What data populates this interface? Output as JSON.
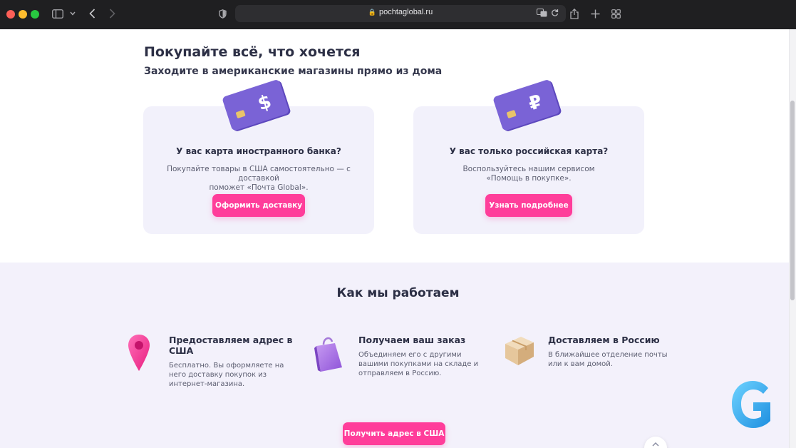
{
  "browser": {
    "url": "pochtaglobal.ru"
  },
  "hero": {
    "title": "Покупайте всё, что хочется",
    "subtitle": "Заходите в американские магазины прямо из дома"
  },
  "cards": [
    {
      "currency_symbol": "$",
      "heading": "У вас карта иностранного банка?",
      "text_line1": "Покупайте товары в США самостоятельно — с доставкой",
      "text_line2": "поможет «Почта Global».",
      "button": "Оформить доставку"
    },
    {
      "currency_symbol": "₽",
      "heading": "У вас только российская карта?",
      "text_line1": "Воспользуйтесь нашим сервисом",
      "text_line2": "«Помощь в покупке».",
      "button": "Узнать подробнее"
    }
  ],
  "how": {
    "title": "Как мы работаем",
    "steps": [
      {
        "icon": "map-pin-icon",
        "title_line1": "Предоставляем адрес в",
        "title_line2": "США",
        "text_line1": "Бесплатно. Вы оформляете на",
        "text_line2": "него доставку покупок из",
        "text_line3": "интернет-магазина."
      },
      {
        "icon": "shopping-bag-icon",
        "title_line1": "Получаем ваш заказ",
        "text_line1": "Объединяем его с другими",
        "text_line2": "вашими покупками на складе и",
        "text_line3": "отправляем в Россию."
      },
      {
        "icon": "parcel-box-icon",
        "title_line1": "Доставляем в Россию",
        "text_line1": "В ближайшее отделение почты",
        "text_line2": "или к вам домой."
      }
    ],
    "cta": "Получить адрес в США"
  },
  "colors": {
    "accent_pink": "#ff3d9a",
    "card_purple": "#6c57c9",
    "section_bg": "#f3f1fb"
  }
}
